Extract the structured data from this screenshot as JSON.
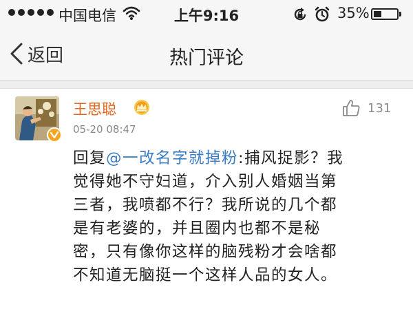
{
  "status_bar": {
    "carrier": "中国电信",
    "time": "上午9:16",
    "battery_percent": "35%",
    "battery_level": 0.35,
    "icons": [
      "signal-dots-icon",
      "wifi-icon",
      "rotation-lock-icon",
      "alarm-icon",
      "battery-icon"
    ]
  },
  "nav": {
    "back_label": "返回",
    "title": "热门评论"
  },
  "comment": {
    "author": "王思聪",
    "timestamp": "05-20 08:47",
    "like_count": "131",
    "reply_prefix": "回复",
    "mention": "@一改名字就掉粉",
    "text_lines": [
      ":捕风捉影？我",
      "觉得她不守妇道，介入别人婚姻当第",
      "三者，我喷都不行？我所说的几个都",
      "是有老婆的，并且圈内也都不是秘",
      "密，只有像你这样的脑残粉才会啥都",
      "不知道无脑挺一个这样人品的女人。"
    ]
  },
  "colors": {
    "author": "#e5651a",
    "mention": "#3a7cc4",
    "verified": "#f4a623",
    "text": "#222222",
    "meta": "#8a8a8a"
  }
}
